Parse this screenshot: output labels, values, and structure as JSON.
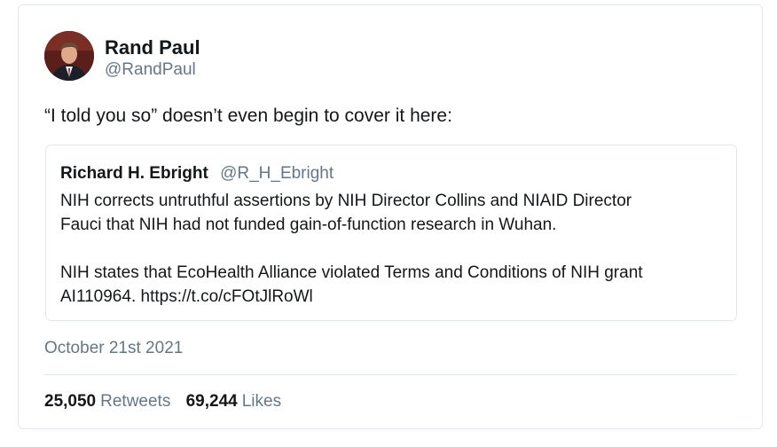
{
  "tweet": {
    "author_name": "Rand Paul",
    "author_handle": "@RandPaul",
    "text": "“I told you so” doesn’t even begin to cover it here:",
    "date": "October 21st 2021",
    "retweets_count": "25,050",
    "retweets_label": "Retweets",
    "likes_count": "69,244",
    "likes_label": "Likes"
  },
  "quoted_tweet": {
    "author_name": "Richard H. Ebright",
    "author_handle": "@R_H_Ebright",
    "paragraph1_line1": "NIH corrects untruthful assertions by NIH Director Collins and NIAID Director",
    "paragraph1_line2": "Fauci that NIH had not funded gain-of-function research in Wuhan.",
    "paragraph2_line1": "NIH states that EcoHealth Alliance violated Terms and Conditions of NIH grant",
    "paragraph2_line2": "AI110964. https://t.co/cFOtJlRoWl"
  },
  "colors": {
    "primary_text": "#14171a",
    "secondary_text": "#657786",
    "border": "#e1e8ed"
  }
}
